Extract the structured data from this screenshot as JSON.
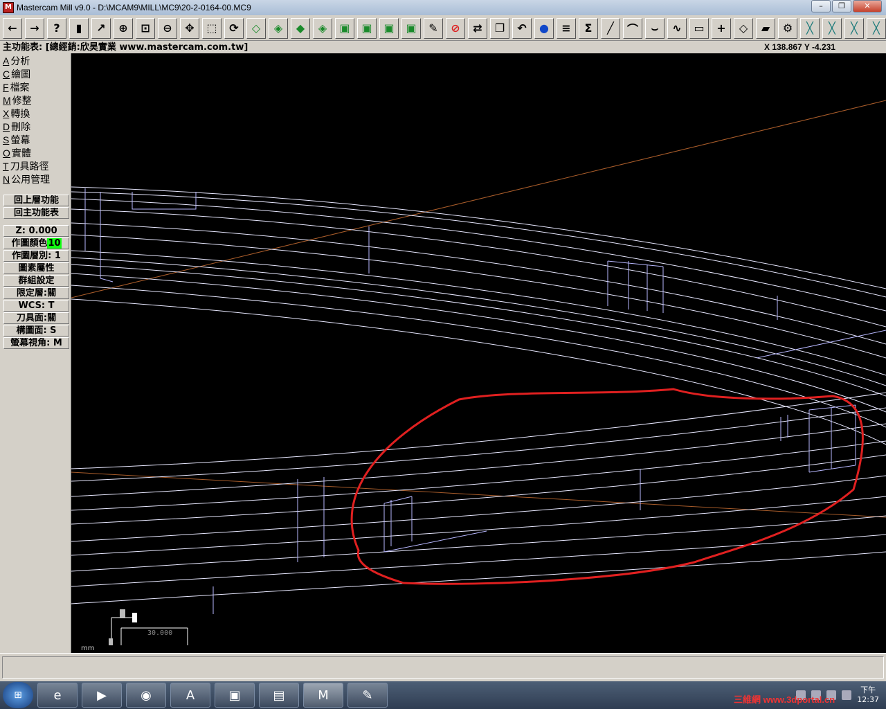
{
  "window": {
    "title": "Mastercam Mill v9.0 - D:\\MCAM9\\MILL\\MC9\\20-2-0164-00.MC9",
    "icon": "mastercam-app-icon",
    "controls": [
      "minimize",
      "restore",
      "close"
    ]
  },
  "toolbar": {
    "buttons": [
      "back-arrow-icon",
      "forward-arrow-icon",
      "help-icon",
      "save-icon",
      "analyze-icon",
      "zoom-window-icon",
      "zoom-fit-icon",
      "zoom-out-icon",
      "pan-icon",
      "select-icon",
      "rotate-view-icon",
      "view-iso-icon",
      "view-top-icon",
      "view-front-icon",
      "view-side-icon",
      "view-cube-1-icon",
      "view-cube-2-icon",
      "view-cube-3-icon",
      "view-cube-4-icon",
      "pencil-icon",
      "no-entry-icon",
      "transform-icon",
      "copy-icon",
      "undo-icon",
      "sphere-icon",
      "layers-icon",
      "sigma-icon",
      "line-icon",
      "arc-icon",
      "fillet-icon",
      "spline-icon",
      "rectangle-icon",
      "point-icon",
      "surface-icon",
      "solid-box-icon",
      "tool-icon",
      "trim-1-icon",
      "trim-2-icon",
      "trim-3-icon",
      "trim-4-icon"
    ]
  },
  "menubar": {
    "title": "主功能表: [總經銷:欣昊實業 www.mastercam.com.tw]",
    "coords": "X 138.867  Y -4.231"
  },
  "main_menu": [
    {
      "key": "A",
      "label": "分析"
    },
    {
      "key": "C",
      "label": "繪圖"
    },
    {
      "key": "F",
      "label": "檔案"
    },
    {
      "key": "M",
      "label": "修整"
    },
    {
      "key": "X",
      "label": "轉換"
    },
    {
      "key": "D",
      "label": "刪除"
    },
    {
      "key": "S",
      "label": "螢幕"
    },
    {
      "key": "O",
      "label": "實體"
    },
    {
      "key": "T",
      "label": "刀具路徑"
    },
    {
      "key": "N",
      "label": "公用管理"
    }
  ],
  "nav_buttons": [
    "回上層功能",
    "回主功能表"
  ],
  "settings": {
    "z": "Z:  0.000",
    "color_label": "作圖顏色",
    "color_value": "10",
    "layer": "作圖層別:  1",
    "attributes": "圖素屬性",
    "group": "群組設定",
    "mask": "限定層:關",
    "wcs": "WCS:  T",
    "toolplane": "刀具面:關",
    "cplane": "構圖面:  S",
    "gview": "螢幕視角:  M"
  },
  "canvas": {
    "scale_label": "30.000",
    "unit": "mm",
    "annotation_color": "#e02020"
  },
  "taskbar": {
    "apps": [
      "start-orb-icon",
      "ie-icon",
      "media-player-icon",
      "chrome-icon",
      "acrobat-icon",
      "contacts-icon",
      "explorer-icon",
      "mastercam-icon",
      "paint-icon"
    ],
    "time_period": "下午",
    "time": "12:37",
    "watermark": "三維網 www.3dportal.cn"
  }
}
